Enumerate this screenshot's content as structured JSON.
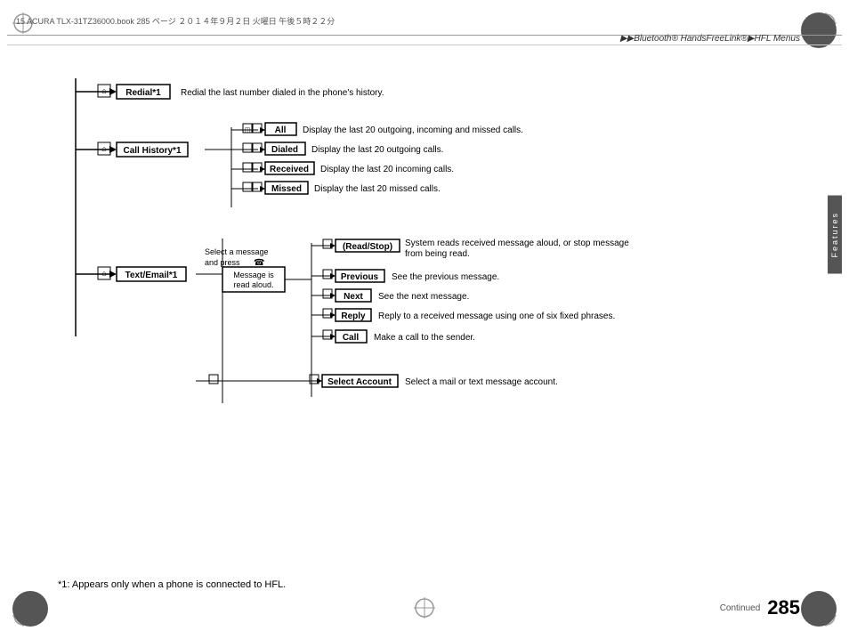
{
  "page": {
    "top_strip_text": "15 ACURA TLX-31TZ36000.book  285 ページ  ２０１４年９月２日  火曜日  午後５時２２分",
    "breadcrumb": "▶▶Bluetooth® HandsFreeLink®▶HFL Menus",
    "side_tab_text": "Features",
    "footer_note": "*1: Appears only when a phone is connected to HFL.",
    "continued_label": "Continued",
    "page_number": "285"
  },
  "diagram": {
    "redial_label": "Redial*1",
    "redial_desc": "Redial the last number dialed in the phone's history.",
    "call_history_label": "Call History*1",
    "all_label": "All",
    "all_desc": "Display the last 20 outgoing, incoming and missed calls.",
    "dialed_label": "Dialed",
    "dialed_desc": "Display the last 20 outgoing calls.",
    "received_label": "Received",
    "received_desc": "Display the last 20 incoming calls.",
    "missed_label": "Missed",
    "missed_desc": "Display the last 20 missed calls.",
    "text_email_label": "Text/Email*1",
    "select_msg_text": "Select a message",
    "and_press_text": "and press",
    "message_read_label": "Message is",
    "message_read_label2": "read aloud.",
    "read_stop_label": "(Read/Stop)",
    "read_stop_desc": "System reads received message aloud, or stop message from being read.",
    "previous_label": "Previous",
    "previous_desc": "See the previous message.",
    "next_label": "Next",
    "next_desc": "See the next message.",
    "reply_label": "Reply",
    "reply_desc": "Reply to a received message using one of six fixed phrases.",
    "call_label": "Call",
    "call_desc": "Make a call to the sender.",
    "select_account_label": "Select Account",
    "select_account_desc": "Select a mail or text message account."
  }
}
